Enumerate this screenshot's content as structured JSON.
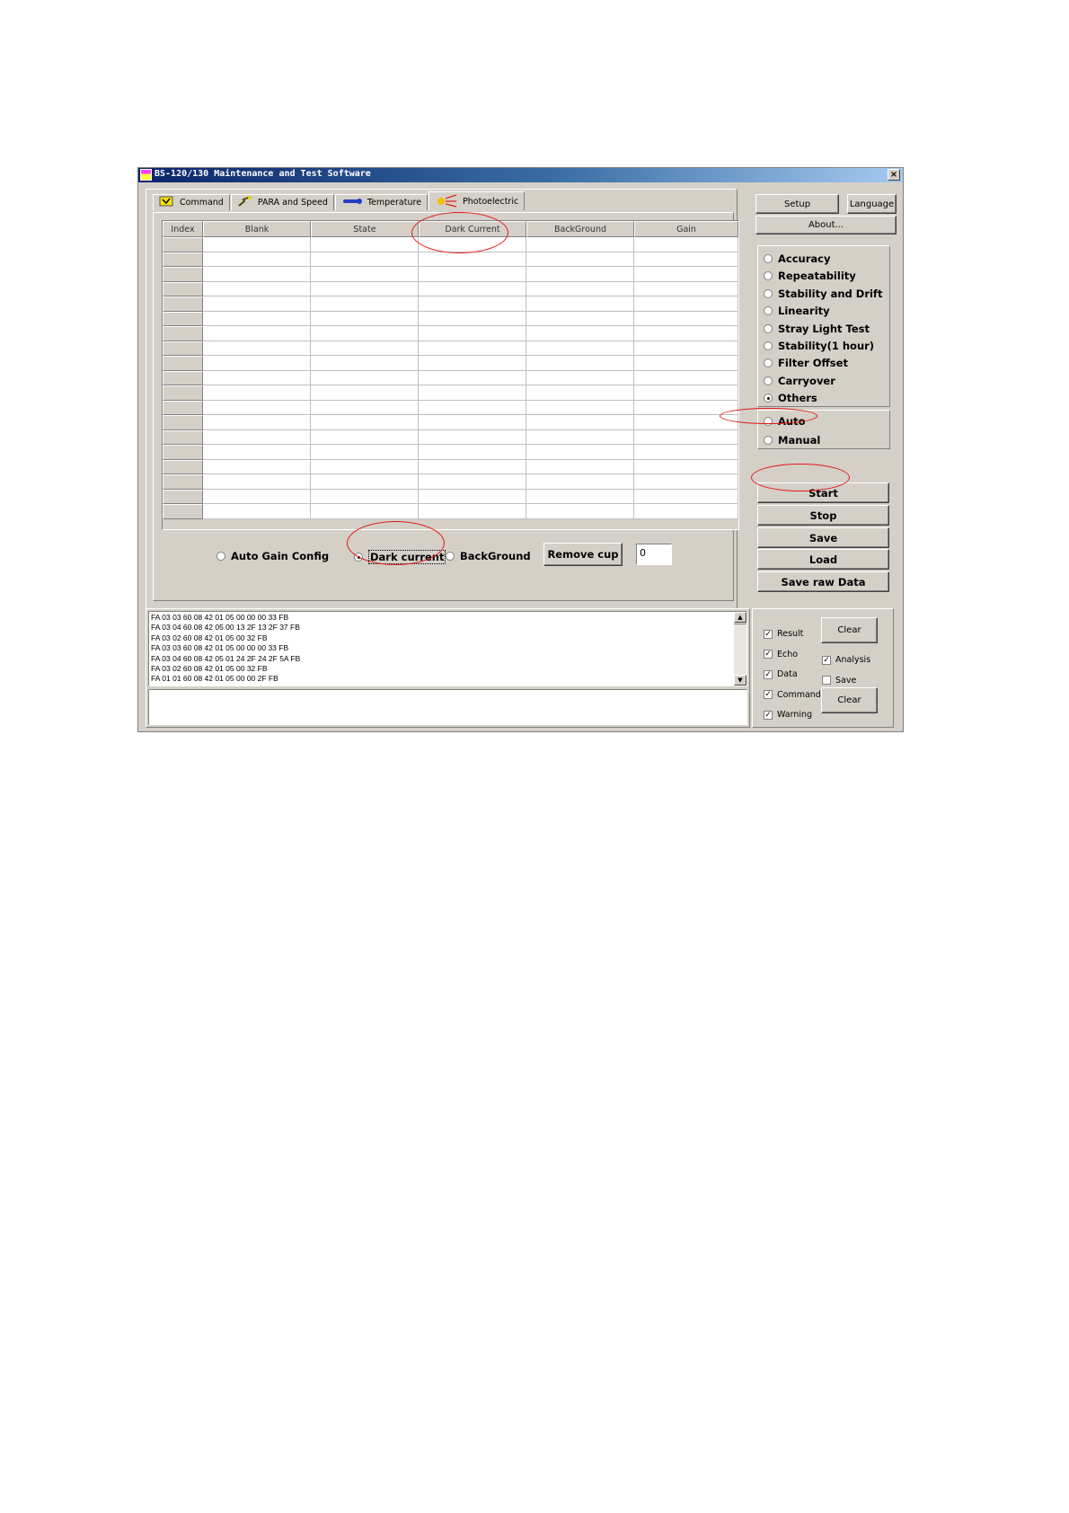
{
  "window": {
    "title": "BS-120/130 Maintenance and Test Software",
    "close_glyph": "×"
  },
  "tabs": [
    {
      "label": "Command",
      "icon": "command-icon"
    },
    {
      "label": "PARA and Speed",
      "icon": "para-speed-icon"
    },
    {
      "label": "Temperature",
      "icon": "temperature-icon"
    },
    {
      "label": "Photoelectric",
      "icon": "photoelectric-icon",
      "active": true
    }
  ],
  "grid": {
    "columns": [
      "Index",
      "Blank",
      "State",
      "Dark Current",
      "BackGround",
      "Gain"
    ],
    "row_count": 19
  },
  "bottom_options": {
    "auto_gain_config": "Auto Gain Config",
    "dark_current": "Dark current",
    "background": "BackGround",
    "selected": "Dark current",
    "remove_cup": "Remove cup",
    "cup_value": "0"
  },
  "side": {
    "setup": "Setup",
    "language": "Language",
    "about": "About...",
    "test_types": [
      "Accuracy",
      "Repeatability",
      "Stability and Drift",
      "Linearity",
      "Stray Light Test",
      "Stability(1 hour)",
      "Filter Offset",
      "Carryover",
      "Others"
    ],
    "selected_test": "Others",
    "modes": [
      "Auto",
      "Manual"
    ],
    "selected_mode": null,
    "buttons": [
      "Start",
      "Stop",
      "Save",
      "Load",
      "Save raw Data"
    ]
  },
  "log": {
    "lines": [
      "FA 03 03 60 08 42 01 05 00 00 00 33 FB",
      "FA 03 04 60 08 42 05 00 13 2F 13 2F 37 FB",
      "FA 03 02 60 08 42 01 05 00 32 FB",
      "FA 03 03 60 08 42 01 05 00 00 00 33 FB",
      "FA 03 04 60 08 42 05 01 24 2F 24 2F 5A FB",
      "FA 03 02 60 08 42 01 05 00 32 FB",
      "FA 01 01 60 08 42 01 05 00 00 2F FB"
    ],
    "scroll_up_glyph": "▲",
    "scroll_down_glyph": "▼",
    "input_value": ""
  },
  "filters": {
    "left": [
      {
        "label": "Result",
        "checked": true
      },
      {
        "label": "Echo",
        "checked": true
      },
      {
        "label": "Data",
        "checked": true
      },
      {
        "label": "Command",
        "checked": true
      },
      {
        "label": "Warning",
        "checked": true
      }
    ],
    "right": [
      {
        "label": "Analysis",
        "checked": true
      },
      {
        "label": "Save",
        "checked": false
      }
    ],
    "clear_top": "Clear",
    "clear_bottom": "Clear",
    "check_glyph": "✓"
  }
}
